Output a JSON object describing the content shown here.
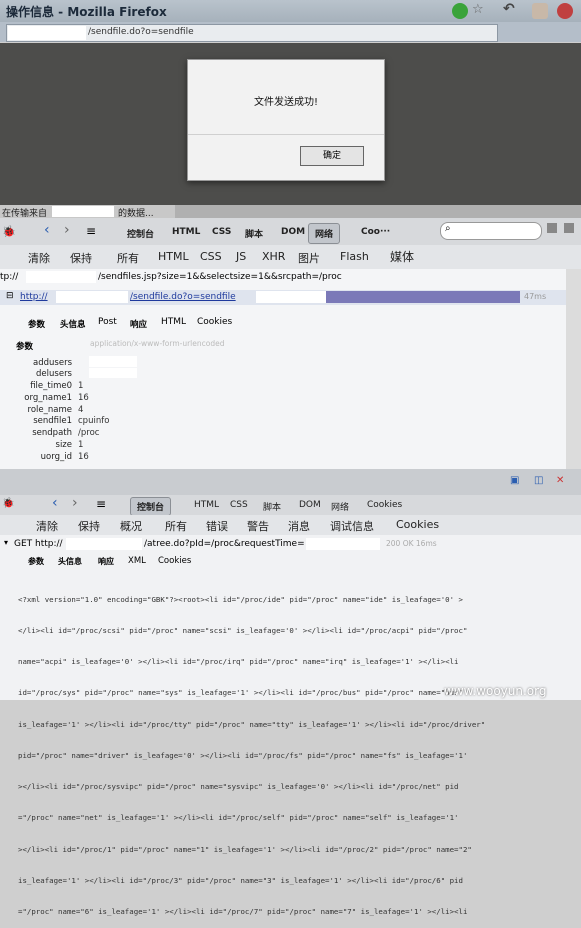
{
  "browser": {
    "window_title": "操作信息 - Mozilla Firefox",
    "url_text": "/sendfile.do?o=sendfile",
    "status_text_prefix": "在传输来自",
    "status_text_suffix": "的数据..."
  },
  "dialog": {
    "message": "文件发送成功!",
    "ok_label": "确定"
  },
  "firebug_top": {
    "toolbar_tabs": [
      "控制台",
      "HTML",
      "CSS",
      "脚本",
      "DOM",
      "网络",
      "Coo···"
    ],
    "filter_tabs": [
      "清除",
      "保持",
      "所有",
      "HTML",
      "CSS",
      "JS",
      "XHR",
      "图片",
      "Flash",
      "媒体"
    ],
    "prev_request": "tp://",
    "prev_request_path": "/sendfiles.jsp?size=1&&selectsize=1&&srcpath=/proc",
    "request_prefix": "http://",
    "request_path": "/sendfile.do?o=sendfile",
    "request_time": "47ms",
    "detail_tabs": [
      "参数",
      "头信息",
      "Post",
      "响应",
      "HTML",
      "Cookies"
    ],
    "params_header": "参数",
    "content_type": "application/x-www-form-urlencoded",
    "params": [
      {
        "key": "addusers",
        "value": ""
      },
      {
        "key": "delusers",
        "value": ""
      },
      {
        "key": "file_time0",
        "value": "1"
      },
      {
        "key": "org_name1",
        "value": "16"
      },
      {
        "key": "role_name",
        "value": "4"
      },
      {
        "key": "sendfile1",
        "value": "cpuinfo"
      },
      {
        "key": "sendpath",
        "value": "/proc"
      },
      {
        "key": "size",
        "value": "1"
      },
      {
        "key": "uorg_id",
        "value": "16"
      }
    ]
  },
  "firebug_bottom": {
    "toolbar_tabs": [
      "控制台",
      "HTML",
      "CSS",
      "脚本",
      "DOM",
      "网络",
      "Cookies"
    ],
    "filter_tabs": [
      "清除",
      "保持",
      "概况",
      "所有",
      "错误",
      "警告",
      "消息",
      "调试信息",
      "Cookies"
    ],
    "request_prefix": "GET http://",
    "request_path": "/atree.do?pId=/proc&requestTime=",
    "request_meta": "200 OK 16ms",
    "detail_tabs": [
      "参数",
      "头信息",
      "响应",
      "XML",
      "Cookies"
    ],
    "xml_lines": [
      "<?xml version=\"1.0\" encoding=\"GBK\"?><root><li id=\"/proc/ide\" pid=\"/proc\" name=\"ide\" is_leafage='0' >",
      "</li><li id=\"/proc/scsi\" pid=\"/proc\" name=\"scsi\" is_leafage='0' ></li><li id=\"/proc/acpi\" pid=\"/proc\"",
      "name=\"acpi\" is_leafage='0' ></li><li id=\"/proc/irq\" pid=\"/proc\" name=\"irq\" is_leafage='1' ></li><li",
      "id=\"/proc/sys\" pid=\"/proc\" name=\"sys\" is_leafage='1' ></li><li id=\"/proc/bus\" pid=\"/proc\" name=\"bus\"",
      "is_leafage='1' ></li><li id=\"/proc/tty\" pid=\"/proc\" name=\"tty\" is_leafage='1' ></li><li id=\"/proc/driver\"",
      "pid=\"/proc\" name=\"driver\" is_leafage='0' ></li><li id=\"/proc/fs\" pid=\"/proc\" name=\"fs\" is_leafage='1'",
      "></li><li id=\"/proc/sysvipc\" pid=\"/proc\" name=\"sysvipc\" is_leafage='0' ></li><li id=\"/proc/net\" pid",
      "=\"/proc\" name=\"net\" is_leafage='1' ></li><li id=\"/proc/self\" pid=\"/proc\" name=\"self\" is_leafage='1'",
      "></li><li id=\"/proc/1\" pid=\"/proc\" name=\"1\" is_leafage='1' ></li><li id=\"/proc/2\" pid=\"/proc\" name=\"2\"",
      "is_leafage='1' ></li><li id=\"/proc/3\" pid=\"/proc\" name=\"3\" is_leafage='1' ></li><li id=\"/proc/6\" pid",
      "=\"/proc\" name=\"6\" is_leafage='1' ></li><li id=\"/proc/7\" pid=\"/proc\" name=\"7\" is_leafage='1' ></li><li"
    ]
  },
  "watermark": "www.wooyun.org"
}
